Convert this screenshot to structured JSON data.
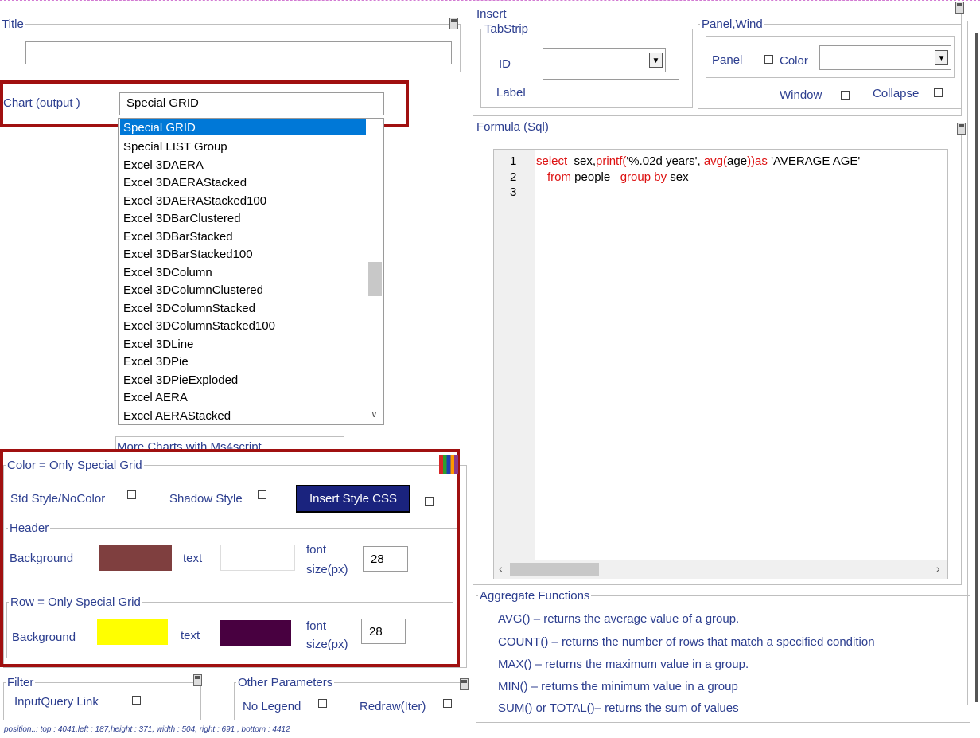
{
  "title_section": {
    "legend": "Title",
    "value": ""
  },
  "chart": {
    "label": "Chart (output )",
    "selected": "Special GRID",
    "options": [
      "Special GRID",
      "Special LIST Group",
      "Excel  3DAERA",
      "Excel 3DAERAStacked",
      "Excel 3DAERAStacked100",
      "Excel  3DBarClustered",
      "Excel 3DBarStacked",
      "Excel 3DBarStacked100",
      "Excel 3DColumn",
      "Excel 3DColumnClustered",
      "Excel 3DColumnStacked",
      "Excel 3DColumnStacked100",
      "Excel 3DLine",
      "Excel 3DPie",
      "Excel 3DPieExploded",
      "Excel AERA",
      "Excel AERAStacked"
    ],
    "more_link": "More Charts with Ms4script"
  },
  "insert": {
    "legend": "Insert",
    "tabstrip": {
      "legend": "TabStrip",
      "id_label": "ID",
      "label_label": "Label"
    },
    "panel": {
      "legend": "Panel,Wind",
      "panel_label": "Panel",
      "color_label": "Color",
      "window_label": "Window",
      "collapse_label": "Collapse"
    }
  },
  "formula": {
    "legend": "Formula (Sql)",
    "line_numbers": [
      "1",
      "2",
      "3"
    ],
    "line1": {
      "kw1": "select",
      "t1": "  sex,",
      "fn1": "printf(",
      "str1": "'%.02d years', ",
      "fn2": "avg(",
      "t2": "age",
      "fn3": "))as",
      "t3": " 'AVERAGE AGE'"
    },
    "line2": {
      "kw1": "from",
      "t1": " people   ",
      "kw2": "group by",
      "t2": " sex"
    }
  },
  "color_section": {
    "legend": "Color = Only Special Grid",
    "std_style_label": "Std Style/NoColor",
    "shadow_style_label": "Shadow Style",
    "insert_css_button": "Insert Style CSS",
    "header": {
      "legend": "Header",
      "background_label": "Background",
      "text_label": "text",
      "font_label_1": "font",
      "font_label_2": "size(px)",
      "font_size": "28",
      "bg_color": "#7f3f3f",
      "text_color": "#ffffff"
    },
    "row": {
      "legend": "Row = Only Special Grid",
      "background_label": "Background",
      "text_label": "text",
      "font_label_1": "font",
      "font_label_2": "size(px)",
      "font_size": "28",
      "bg_color": "#ffff00",
      "text_color": "#480040"
    }
  },
  "aggregate": {
    "legend": "Aggregate Functions",
    "items": [
      "AVG() – returns the average value of a group.",
      "COUNT() – returns the number of rows that match a specified condition",
      "MAX() – returns the maximum value in a group.",
      "MIN() – returns the minimum value in a group",
      "SUM() or TOTAL()– returns the sum of values"
    ]
  },
  "filter": {
    "legend": "Filter",
    "inputquery_label": "InputQuery Link"
  },
  "other": {
    "legend": "Other Parameters",
    "no_legend_label": "No Legend",
    "redraw_label": "Redraw(Iter)"
  },
  "status": "position..:  top : 4041,left : 187,height : 371, width  : 504, right : 691 , bottom : 4412",
  "colors": {
    "accent_red": "#a01010",
    "label_blue": "#2c3e8f",
    "button_bg": "#1a237e"
  }
}
